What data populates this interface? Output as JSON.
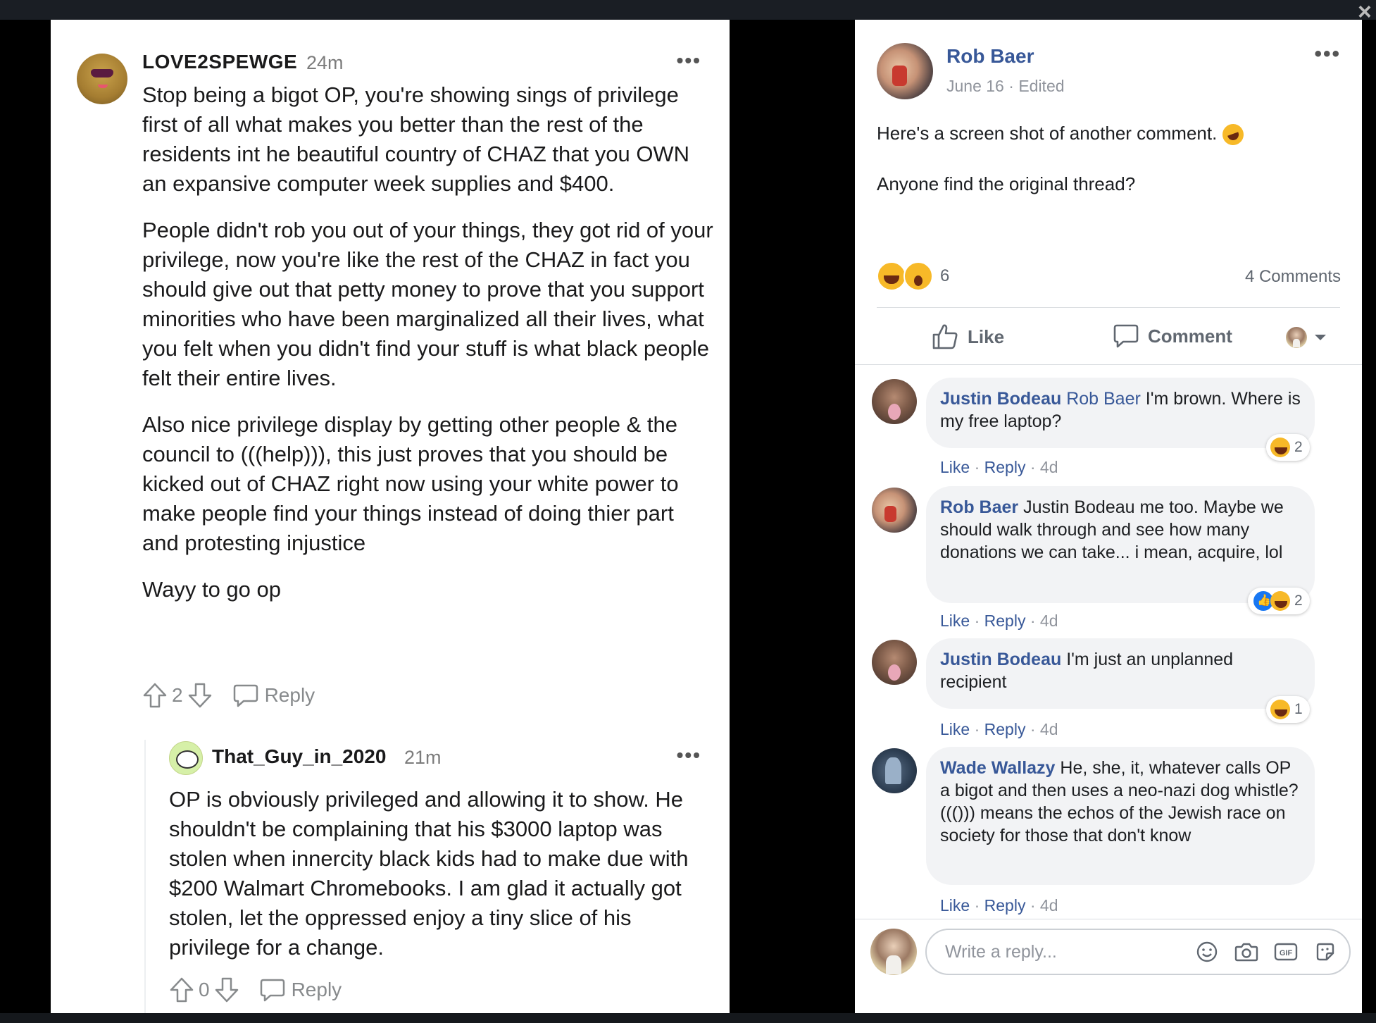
{
  "reddit": {
    "comment": {
      "username": "LOVE2SPEWGE",
      "time": "24m",
      "paragraphs": [
        "Stop being a bigot OP, you're showing sings of privilege first of all what makes you better than the rest of the residents int he beautiful country of CHAZ that you OWN an expansive computer week supplies and $400.",
        "People didn't rob you out of your things, they got rid of your privilege, now you're like the rest of the CHAZ in fact you should give out that petty money to prove that you support minorities who have been marginalized all their lives, what you felt when you didn't find your stuff is what black people felt their entire lives.",
        "Also nice privilege display by getting other people & the council to (((help))), this just proves that you should be kicked out of CHAZ right now using your white power to make people find your things instead of doing thier part and protesting injustice",
        "Wayy to go op"
      ],
      "votes": "2",
      "reply_label": "Reply"
    },
    "reply": {
      "username": "That_Guy_in_2020",
      "time": "21m",
      "text": "OP is obviously privileged and allowing it to show. He shouldn't be complaining that his $3000 laptop was stolen when innercity black kids had to make due with $200 Walmart Chromebooks. I am glad it actually got stolen, let the oppressed enjoy a tiny slice of his privilege for a change.",
      "votes": "0",
      "reply_label": "Reply"
    },
    "more_glyph": "•••"
  },
  "facebook": {
    "post": {
      "author": "Rob Baer",
      "date": "June 16",
      "dot": " · ",
      "edited": "Edited",
      "line1": "Here's a screen shot of another comment.",
      "line2": "Anyone find the original thread?",
      "reaction_count": "6",
      "comments_count": "4 Comments"
    },
    "actions": {
      "like": "Like",
      "comment": "Comment"
    },
    "comments": [
      {
        "name": "Justin Bodeau",
        "tag": "Rob Baer",
        "text": " I'm brown. Where is my free laptop?",
        "like": "Like",
        "reply": "Reply",
        "time": "4d",
        "reactions": "2"
      },
      {
        "name": "Rob Baer",
        "tag": "",
        "text": " Justin Bodeau me too. Maybe we should walk through and see how many donations we can take... i mean, acquire, lol",
        "like": "Like",
        "reply": "Reply",
        "time": "4d",
        "reactions": "2"
      },
      {
        "name": "Justin Bodeau",
        "tag": "",
        "text": " I'm just an unplanned recipient",
        "like": "Like",
        "reply": "Reply",
        "time": "4d",
        "reactions": "1"
      },
      {
        "name": "Wade Wallazy",
        "tag": "",
        "text": " He, she, it, whatever calls OP a bigot and then uses a neo-nazi dog whistle? ((())) means the echos of the Jewish race on society for those that don't know",
        "like": "Like",
        "reply": "Reply",
        "time": "4d"
      }
    ],
    "write_placeholder": "Write a reply...",
    "sep": " · ",
    "more_glyph": "•••"
  },
  "icons": [
    "upvote-icon",
    "downvote-icon",
    "reply-icon",
    "like-icon",
    "comment-icon",
    "emoji-icon",
    "camera-icon",
    "gif-icon",
    "sticker-icon",
    "close-icon"
  ],
  "colors": {
    "fb_link": "#385898",
    "reddit_meta": "#878a8c",
    "fb_bubble": "#f2f3f5"
  }
}
